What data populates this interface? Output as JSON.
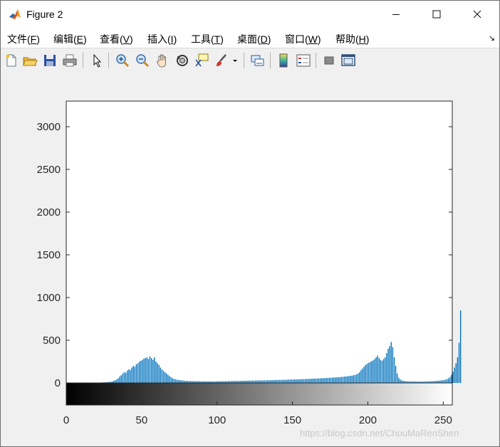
{
  "window": {
    "title": "Figure 2"
  },
  "menu": {
    "items": [
      {
        "label": "文件(",
        "key": "F",
        "tail": ")"
      },
      {
        "label": "编辑(",
        "key": "E",
        "tail": ")"
      },
      {
        "label": "查看(",
        "key": "V",
        "tail": ")"
      },
      {
        "label": "插入(",
        "key": "I",
        "tail": ")"
      },
      {
        "label": "工具(",
        "key": "T",
        "tail": ")"
      },
      {
        "label": "桌面(",
        "key": "D",
        "tail": ")"
      },
      {
        "label": "窗口(",
        "key": "W",
        "tail": ")"
      },
      {
        "label": "帮助(",
        "key": "H",
        "tail": ")"
      }
    ]
  },
  "toolbar": {
    "icons": [
      "new-file-icon",
      "open-folder-icon",
      "save-icon",
      "print-icon",
      "pointer-icon",
      "zoom-in-icon",
      "zoom-out-icon",
      "pan-hand-icon",
      "rotate-3d-icon",
      "data-cursor-icon",
      "brush-icon",
      "link-plot-icon",
      "colorbar-icon",
      "legend-icon",
      "hide-plot-tools-icon",
      "show-plot-tools-icon"
    ]
  },
  "colors": {
    "bars": "#0072bd",
    "axes": "#262626",
    "background": "#f0f0f0"
  },
  "watermark": "https://blog.csdn.net/ChouMaRenShen",
  "chart_data": {
    "type": "bar",
    "title": "",
    "xlabel": "",
    "ylabel": "",
    "xlim": [
      0,
      255
    ],
    "ylim": [
      0,
      3300
    ],
    "xticks": [
      0,
      50,
      100,
      150,
      200,
      250
    ],
    "yticks": [
      0,
      500,
      1000,
      1500,
      2000,
      2500,
      3000
    ],
    "grayscale_colorbar": {
      "from": 0,
      "to": 255
    },
    "series": [
      {
        "values": [
          0,
          0,
          0,
          0,
          0,
          0,
          0,
          0,
          0,
          0,
          0,
          0,
          0,
          0,
          0,
          0,
          0,
          0,
          0,
          0,
          2,
          3,
          4,
          5,
          6,
          7,
          9,
          10,
          12,
          14,
          18,
          25,
          33,
          42,
          55,
          75,
          90,
          110,
          125,
          120,
          145,
          160,
          150,
          180,
          200,
          190,
          220,
          230,
          250,
          260,
          270,
          285,
          290,
          300,
          280,
          310,
          290,
          270,
          300,
          250,
          230,
          210,
          180,
          160,
          140,
          125,
          110,
          95,
          80,
          65,
          55,
          48,
          42,
          38,
          35,
          32,
          30,
          28,
          26,
          25,
          24,
          23,
          22,
          22,
          21,
          21,
          20,
          20,
          20,
          19,
          19,
          19,
          18,
          18,
          18,
          18,
          18,
          18,
          18,
          19,
          19,
          19,
          20,
          20,
          20,
          21,
          21,
          22,
          22,
          22,
          23,
          23,
          24,
          24,
          24,
          25,
          25,
          25,
          26,
          26,
          27,
          27,
          27,
          28,
          28,
          28,
          29,
          29,
          30,
          30,
          30,
          31,
          31,
          32,
          32,
          32,
          33,
          33,
          34,
          34,
          35,
          35,
          36,
          36,
          37,
          37,
          38,
          39,
          39,
          40,
          40,
          41,
          42,
          42,
          43,
          44,
          44,
          45,
          46,
          46,
          47,
          48,
          49,
          50,
          50,
          51,
          52,
          53,
          54,
          55,
          56,
          57,
          58,
          59,
          60,
          61,
          62,
          63,
          65,
          66,
          67,
          69,
          70,
          72,
          74,
          76,
          78,
          80,
          83,
          86,
          90,
          95,
          100,
          110,
          125,
          150,
          170,
          190,
          210,
          225,
          235,
          245,
          255,
          265,
          280,
          300,
          320,
          290,
          270,
          260,
          280,
          300,
          350,
          400,
          430,
          480,
          420,
          300,
          200,
          110,
          60,
          40,
          30,
          25,
          22,
          20,
          19,
          18,
          18,
          17,
          17,
          17,
          16,
          16,
          16,
          16,
          16,
          17,
          17,
          18,
          19,
          20,
          21,
          22,
          23,
          24,
          25,
          27,
          29,
          31,
          34,
          38,
          45,
          55,
          70,
          95,
          130,
          180,
          230,
          300,
          470,
          850
        ]
      }
    ]
  }
}
